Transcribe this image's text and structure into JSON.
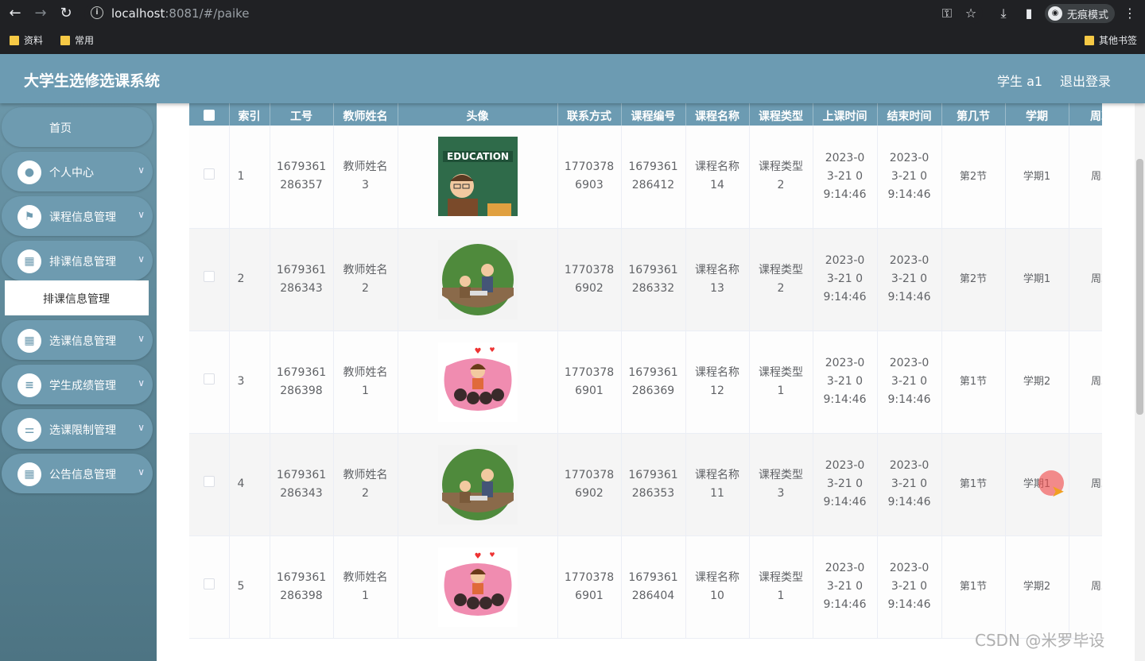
{
  "browser": {
    "url_host": "localhost",
    "url_path": ":8081/#/paike",
    "incognito_label": "无痕模式",
    "bookmarks": [
      "资料",
      "常用"
    ],
    "other_bookmarks": "其他书签"
  },
  "header": {
    "title": "大学生选修选课系统",
    "user": "学生 a1",
    "logout": "退出登录",
    "color": "#6c9bb2"
  },
  "sidebar": {
    "home": "首页",
    "items": [
      {
        "label": "个人中心",
        "icon": "person-icon"
      },
      {
        "label": "课程信息管理",
        "icon": "flag-icon"
      },
      {
        "label": "排课信息管理",
        "icon": "grid-icon"
      },
      {
        "label": "选课信息管理",
        "icon": "grid-icon"
      },
      {
        "label": "学生成绩管理",
        "icon": "list-icon"
      },
      {
        "label": "选课限制管理",
        "icon": "sliders-icon"
      },
      {
        "label": "公告信息管理",
        "icon": "grid-icon"
      }
    ],
    "active_sub": "排课信息管理"
  },
  "table": {
    "columns": [
      "索引",
      "工号",
      "教师姓名",
      "头像",
      "联系方式",
      "课程编号",
      "课程名称",
      "课程类型",
      "上课时间",
      "结束时间",
      "第几节",
      "学期",
      "周次"
    ],
    "rows": [
      {
        "idx": "1",
        "gonghao": "1679361286357",
        "teacher": "教师姓名3",
        "avatar": "education-teacher-image",
        "phone": "17703786903",
        "course_no": "1679361286412",
        "course_name": "课程名称14",
        "course_type": "课程类型2",
        "start": "2023-03-21 09:14:46",
        "end": "2023-03-21 09:14:46",
        "period": "第2节",
        "term": "学期1",
        "week": "周次"
      },
      {
        "idx": "2",
        "gonghao": "1679361286343",
        "teacher": "教师姓名2",
        "avatar": "classroom-round-image",
        "phone": "17703786902",
        "course_no": "1679361286332",
        "course_name": "课程名称13",
        "course_type": "课程类型2",
        "start": "2023-03-21 09:14:46",
        "end": "2023-03-21 09:14:46",
        "period": "第2节",
        "term": "学期1",
        "week": "周次"
      },
      {
        "idx": "3",
        "gonghao": "1679361286398",
        "teacher": "教师姓名1",
        "avatar": "teacher-students-hearts-image",
        "phone": "17703786901",
        "course_no": "1679361286369",
        "course_name": "课程名称12",
        "course_type": "课程类型1",
        "start": "2023-03-21 09:14:46",
        "end": "2023-03-21 09:14:46",
        "period": "第1节",
        "term": "学期2",
        "week": "周次"
      },
      {
        "idx": "4",
        "gonghao": "1679361286343",
        "teacher": "教师姓名2",
        "avatar": "classroom-round-image",
        "phone": "17703786902",
        "course_no": "1679361286353",
        "course_name": "课程名称11",
        "course_type": "课程类型3",
        "start": "2023-03-21 09:14:46",
        "end": "2023-03-21 09:14:46",
        "period": "第1节",
        "term": "学期1",
        "week": "周次"
      },
      {
        "idx": "5",
        "gonghao": "1679361286398",
        "teacher": "教师姓名1",
        "avatar": "teacher-students-hearts-image",
        "phone": "17703786901",
        "course_no": "1679361286404",
        "course_name": "课程名称10",
        "course_type": "课程类型1",
        "start": "2023-03-21 09:14:46",
        "end": "2023-03-21 09:14:46",
        "period": "第1节",
        "term": "学期2",
        "week": "周次"
      }
    ]
  },
  "watermark": "CSDN @米罗毕设"
}
